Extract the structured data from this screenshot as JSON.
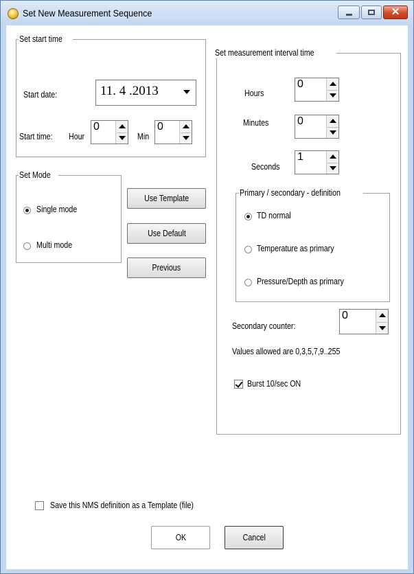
{
  "window": {
    "title": "Set New Measurement Sequence",
    "close_glyph": "✕"
  },
  "start_time_group": {
    "label": "Set start time",
    "start_date_label": "Start date:",
    "start_date_value": "11. 4 .2013",
    "start_time_label": "Start time:",
    "hour_label": "Hour",
    "hour_value": "0",
    "min_label": "Min",
    "min_value": "0"
  },
  "interval_group": {
    "label": "Set measurement interval time",
    "hours_label": "Hours",
    "hours_value": "0",
    "minutes_label": "Minutes",
    "minutes_value": "0",
    "seconds_label": "Seconds",
    "seconds_value": "1",
    "primary_group": {
      "label": "Primary / secondary - definition",
      "options": [
        "TD normal",
        "Temperature as primary",
        "Pressure/Depth as primary"
      ],
      "selected": 0
    },
    "secondary_counter_label": "Secondary counter:",
    "secondary_counter_value": "0",
    "allowed_values_text": "Values allowed are 0,3,5,7,9..255",
    "burst_label": "Burst 10/sec ON",
    "burst_checked": true
  },
  "mode_group": {
    "label": "Set Mode",
    "options": [
      "Single mode",
      "Multi mode"
    ],
    "selected": 0
  },
  "buttons": {
    "use_template": "Use Template",
    "use_default": "Use Default",
    "previous": "Previous",
    "ok": "OK",
    "cancel": "Cancel"
  },
  "save_template_label": "Save this NMS definition as a Template (file)",
  "save_template_checked": false,
  "colors": {
    "titlebar": "#c4d7ee",
    "close_button": "#c9462a",
    "content_bg": "#ffffff"
  },
  "icons": [
    "app-icon",
    "minimize-icon",
    "maximize-icon",
    "close-icon",
    "spin-up-icon",
    "spin-down-icon",
    "dropdown-arrow-icon"
  ]
}
